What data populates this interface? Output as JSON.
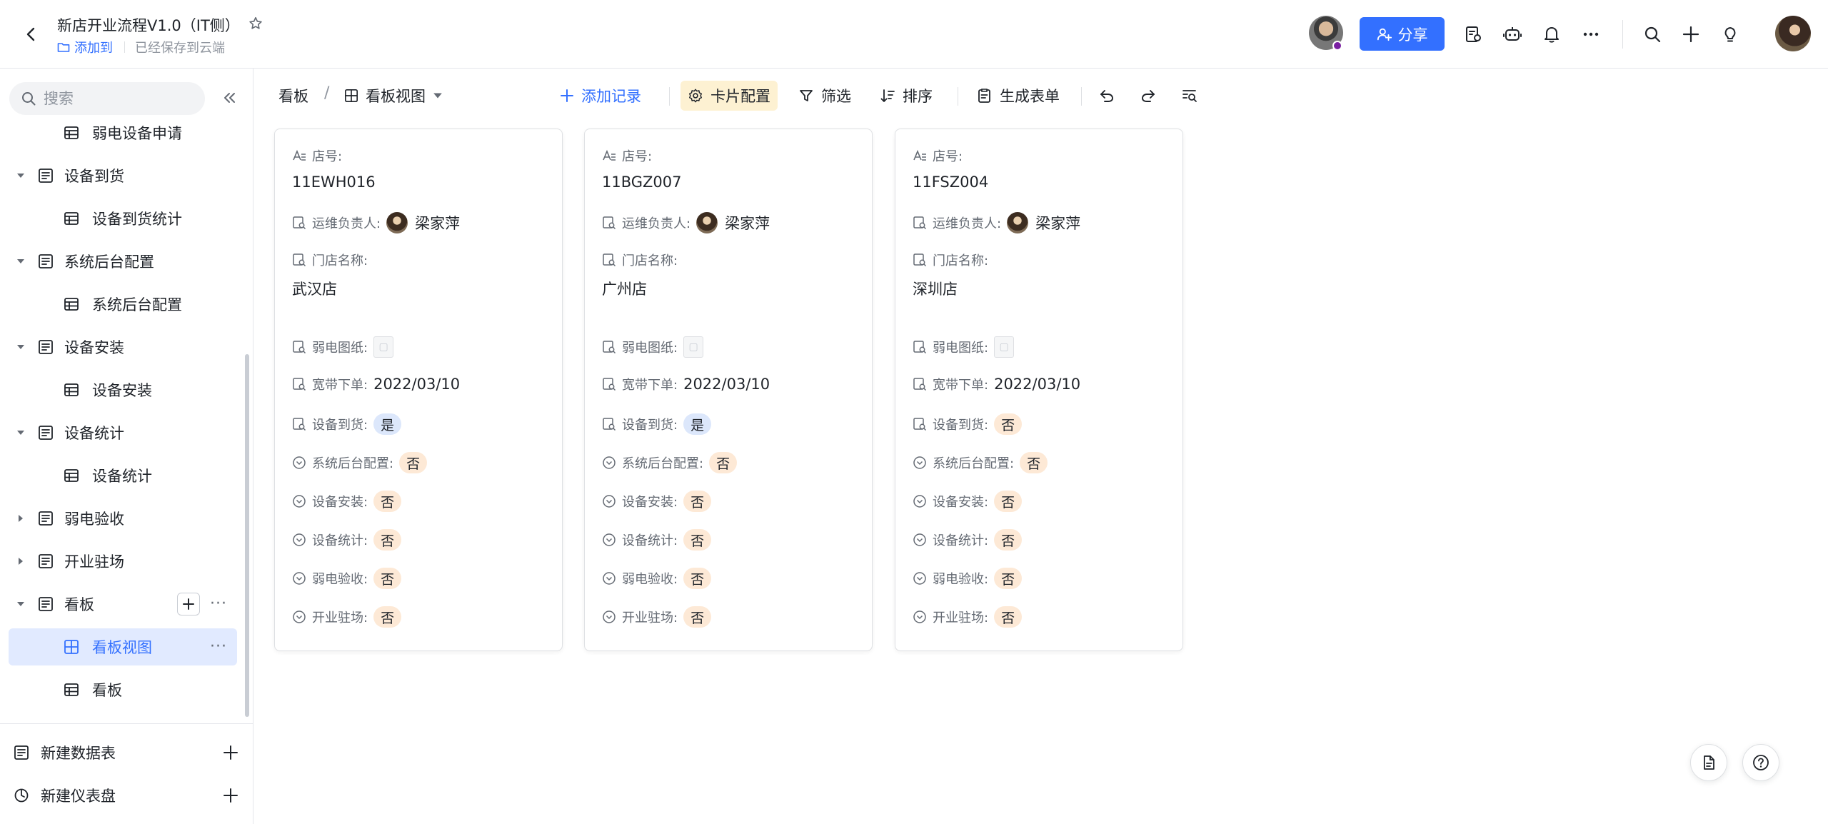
{
  "header": {
    "title": "新店开业流程V1.0（IT侧）",
    "add_to_label": "添加到",
    "saved_label": "已经保存到云端",
    "share_label": "分享"
  },
  "sidebar": {
    "search_placeholder": "搜索",
    "items": [
      {
        "label": "弱电设备申请"
      },
      {
        "label": "设备到货"
      },
      {
        "label": "设备到货统计"
      },
      {
        "label": "系统后台配置"
      },
      {
        "label": "系统后台配置"
      },
      {
        "label": "设备安装"
      },
      {
        "label": "设备安装"
      },
      {
        "label": "设备统计"
      },
      {
        "label": "设备统计"
      },
      {
        "label": "弱电验收"
      },
      {
        "label": "开业驻场"
      },
      {
        "label": "看板"
      },
      {
        "label": "看板视图"
      },
      {
        "label": "看板"
      }
    ],
    "footer": {
      "new_table": "新建数据表",
      "new_dashboard": "新建仪表盘"
    }
  },
  "viewbar": {
    "breadcrumb_root": "看板",
    "view_name": "看板视图",
    "add_record": "添加记录",
    "card_config": "卡片配置",
    "filter": "筛选",
    "sort": "排序",
    "generate_form": "生成表单"
  },
  "field_labels": {
    "store_no": "店号:",
    "ops_owner": "运维负责人:",
    "store_name": "门店名称:",
    "drawing": "弱电图纸:",
    "broadband": "宽带下单:",
    "arrival": "设备到货:",
    "backend": "系统后台配置:",
    "install": "设备安装:",
    "stats": "设备统计:",
    "acceptance": "弱电验收:",
    "opening": "开业驻场:"
  },
  "cards": [
    {
      "store_no": "11EWH016",
      "ops_owner": "梁家萍",
      "store_name": "武汉店",
      "broadband": "2022/03/10",
      "arrival": "是",
      "backend": "否",
      "install": "否",
      "stats": "否",
      "acceptance": "否",
      "opening": "否"
    },
    {
      "store_no": "11BGZ007",
      "ops_owner": "梁家萍",
      "store_name": "广州店",
      "broadband": "2022/03/10",
      "arrival": "是",
      "backend": "否",
      "install": "否",
      "stats": "否",
      "acceptance": "否",
      "opening": "否"
    },
    {
      "store_no": "11FSZ004",
      "ops_owner": "梁家萍",
      "store_name": "深圳店",
      "broadband": "2022/03/10",
      "arrival": "否",
      "backend": "否",
      "install": "否",
      "stats": "否",
      "acceptance": "否",
      "opening": "否"
    }
  ],
  "colors": {
    "accent": "#3370ff",
    "tag_yes_bg": "#dce7fb",
    "tag_no_bg": "#fde9d6",
    "card_config_bg": "#fdf1d2"
  }
}
